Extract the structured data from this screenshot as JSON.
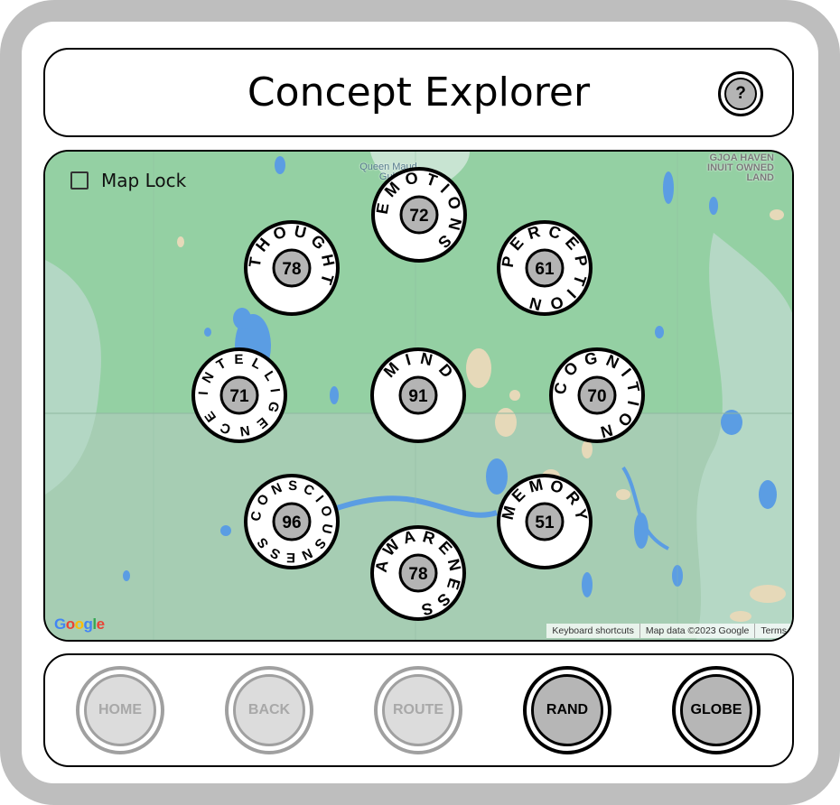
{
  "header": {
    "title": "Concept Explorer",
    "help_label": "?"
  },
  "map": {
    "lock_label": "Map Lock",
    "lock_checked": false,
    "city_label": "Queen Maud Gulf",
    "region_label": "GJOA HAVEN INUIT OWNED LAND",
    "google_logo": "Google",
    "attribution": [
      "Keyboard shortcuts",
      "Map data ©2023 Google",
      "Terms"
    ]
  },
  "nodes": [
    {
      "id": "emotions",
      "label": "EMOTIONS",
      "value": "72"
    },
    {
      "id": "thought",
      "label": "THOUGHT",
      "value": "78"
    },
    {
      "id": "perception",
      "label": "PERCEPTION",
      "value": "61"
    },
    {
      "id": "intelligence",
      "label": "INTELLIGENCE",
      "value": "71"
    },
    {
      "id": "mind",
      "label": "MIND",
      "value": "91"
    },
    {
      "id": "cognition",
      "label": "COGNITION",
      "value": "70"
    },
    {
      "id": "consciousness",
      "label": "CONSCIOUSNESS",
      "value": "96"
    },
    {
      "id": "memory",
      "label": "MEMORY",
      "value": "51"
    },
    {
      "id": "awareness",
      "label": "AWARENESS",
      "value": "78"
    }
  ],
  "footer": {
    "buttons": [
      {
        "label": "HOME",
        "enabled": false
      },
      {
        "label": "BACK",
        "enabled": false
      },
      {
        "label": "ROUTE",
        "enabled": false
      },
      {
        "label": "RAND",
        "enabled": true
      },
      {
        "label": "GLOBE",
        "enabled": true
      }
    ]
  }
}
